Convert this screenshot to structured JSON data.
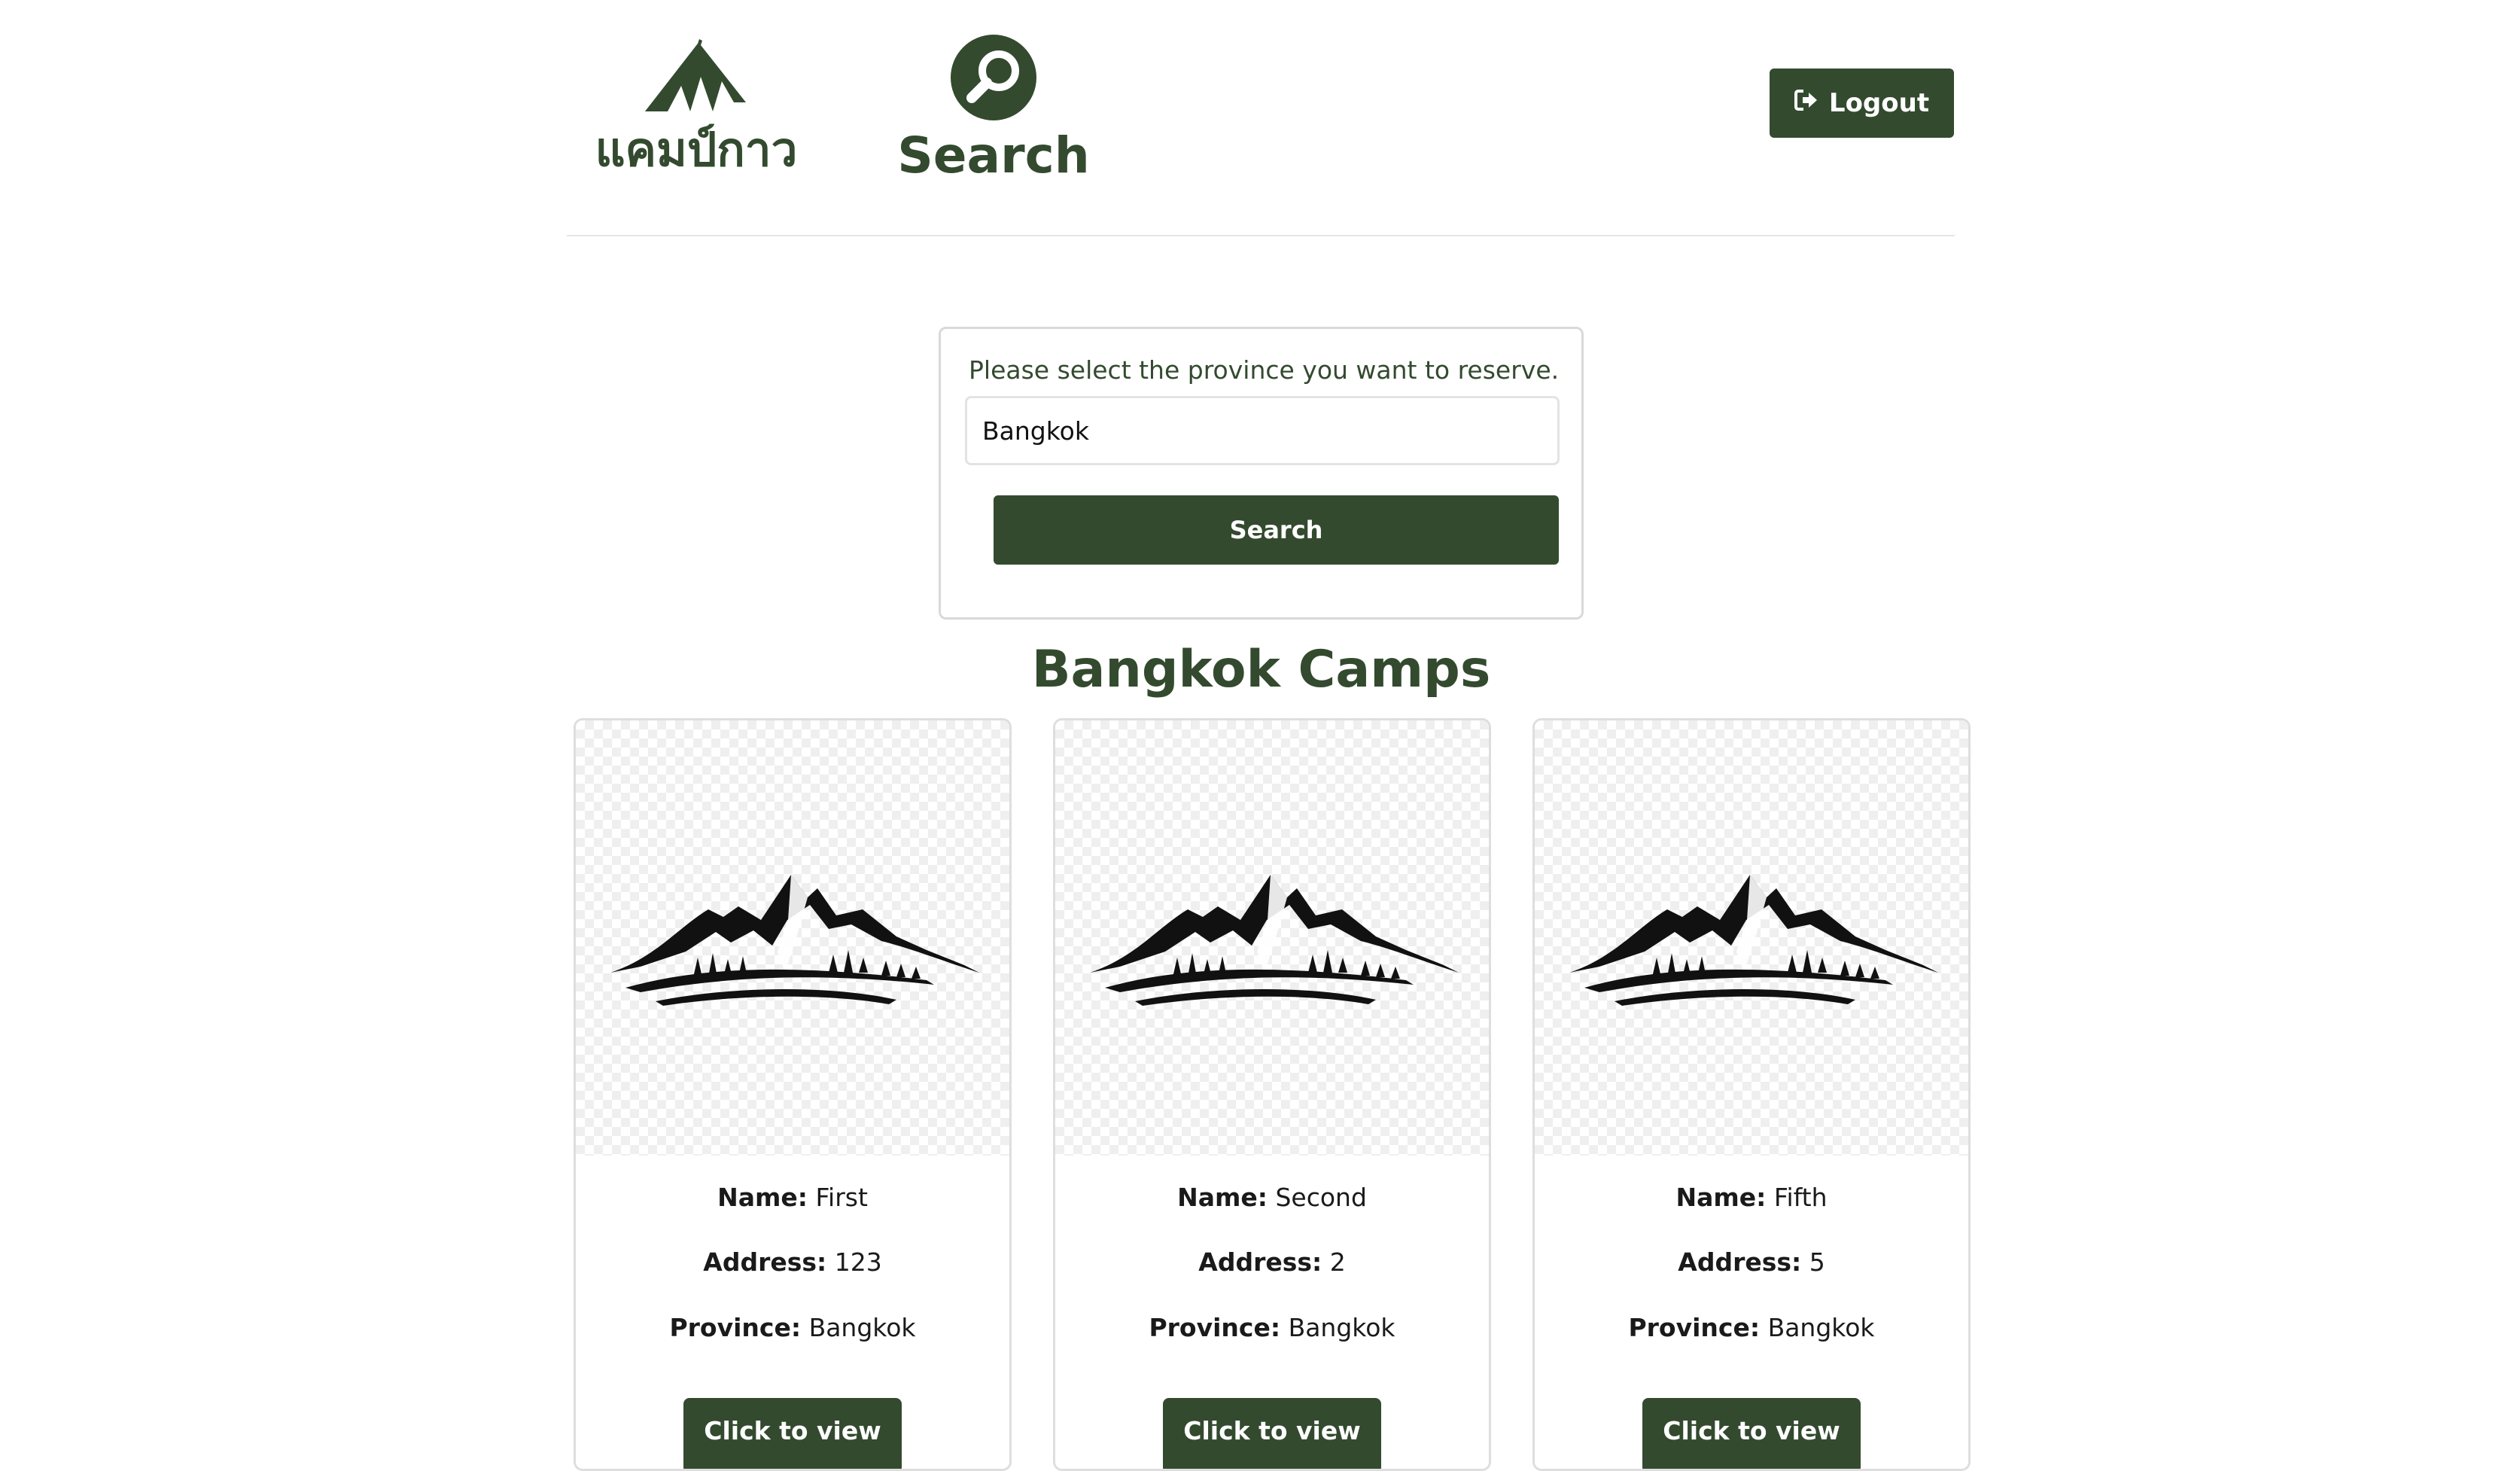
{
  "nav": {
    "brand_label": "แคมป์กาว",
    "search_label": "Search",
    "logout_label": "Logout",
    "brand_icon": "tent-icon",
    "search_icon": "magnifier-icon",
    "logout_icon": "sign-out-icon"
  },
  "search": {
    "prompt": "Please select the province you want to reserve.",
    "value": "Bangkok",
    "button_label": "Search"
  },
  "results": {
    "title": "Bangkok Camps",
    "name_label": "Name:",
    "address_label": "Address:",
    "province_label": "Province:",
    "view_label": "Click to view",
    "camps": [
      {
        "name": "First",
        "address": "123",
        "province": "Bangkok"
      },
      {
        "name": "Second",
        "address": "2",
        "province": "Bangkok"
      },
      {
        "name": "Fifth",
        "address": "5",
        "province": "Bangkok"
      }
    ]
  },
  "colors": {
    "accent": "#334a2f",
    "text": "#1a1a1a",
    "border": "#dedede"
  }
}
